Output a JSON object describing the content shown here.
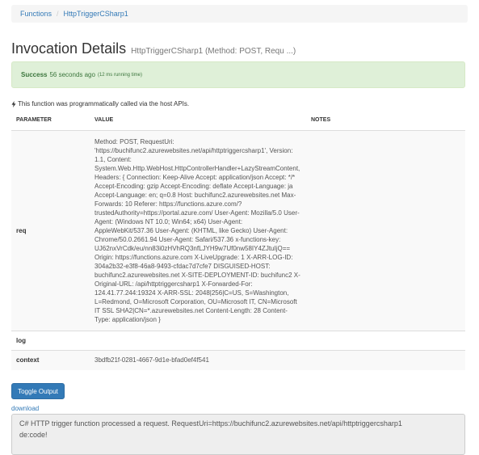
{
  "breadcrumb": {
    "root": "Functions",
    "separator": "/",
    "current": "HttpTriggerCSharp1"
  },
  "header": {
    "title": "Invocation Details",
    "subtitle": "HttpTriggerCSharp1 (Method: POST, Requ ...)"
  },
  "alert": {
    "status": "Success",
    "time": "56 seconds ago",
    "running_time": "(12 ms running time)"
  },
  "note": {
    "icon": "bolt-icon",
    "text": "This function was programmatically called via the host APIs."
  },
  "table": {
    "headers": {
      "parameter": "PARAMETER",
      "value": "VALUE",
      "notes": "NOTES"
    },
    "rows": [
      {
        "parameter": "req",
        "value": "Method: POST, RequestUri: 'https://buchifunc2.azurewebsites.net/api/httptriggercsharp1', Version: 1.1, Content: System.Web.Http.WebHost.HttpControllerHandler+LazyStreamContent, Headers: { Connection: Keep-Alive Accept: application/json Accept: */* Accept-Encoding: gzip Accept-Encoding: deflate Accept-Language: ja Accept-Language: en; q=0.8 Host: buchifunc2.azurewebsites.net Max-Forwards: 10 Referer: https://functions.azure.com/?trustedAuthority=https://portal.azure.com/ User-Agent: Mozilla/5.0 User-Agent: (Windows NT 10.0; Win64; x64) User-Agent: AppleWebKit/537.36 User-Agent: (KHTML, like Gecko) User-Agent: Chrome/50.0.2661.94 User-Agent: Safari/537.36 x-functions-key: UJ62nxVrCdk/eu/nn83i0zHVhRQ3nfLJYH9w7Uf0nw58IY4ZJtuIjQ== Origin: https://functions.azure.com X-LiveUpgrade: 1 X-ARR-LOG-ID: 304a2b32-e3f8-46a8-9493-cfdac7d7cfe7 DISGUISED-HOST: buchifunc2.azurewebsites.net X-SITE-DEPLOYMENT-ID: buchifunc2 X-Original-URL: /api/httptriggercsharp1 X-Forwarded-For: 124.41.77.244:19324 X-ARR-SSL: 2048|256|C=US, S=Washington, L=Redmond, O=Microsoft Corporation, OU=Microsoft IT, CN=Microsoft IT SSL SHA2|CN=*.azurewebsites.net Content-Length: 28 Content-Type: application/json }",
        "notes": ""
      },
      {
        "parameter": "log",
        "value": "",
        "notes": ""
      },
      {
        "parameter": "context",
        "value": "3bdfb21f-0281-4667-9d1e-bfad0ef4f541",
        "notes": ""
      }
    ]
  },
  "toggle_button": "Toggle Output",
  "download_link": "download",
  "output": {
    "line1": "C# HTTP trigger function processed a request. RequestUri=https://buchifunc2.azurewebsites.net/api/httptriggercsharp1",
    "line2": "de:code!"
  },
  "colors": {
    "link": "#337ab7",
    "success_bg": "#dff0d8",
    "success_text": "#3c763d",
    "button": "#337ab7"
  }
}
